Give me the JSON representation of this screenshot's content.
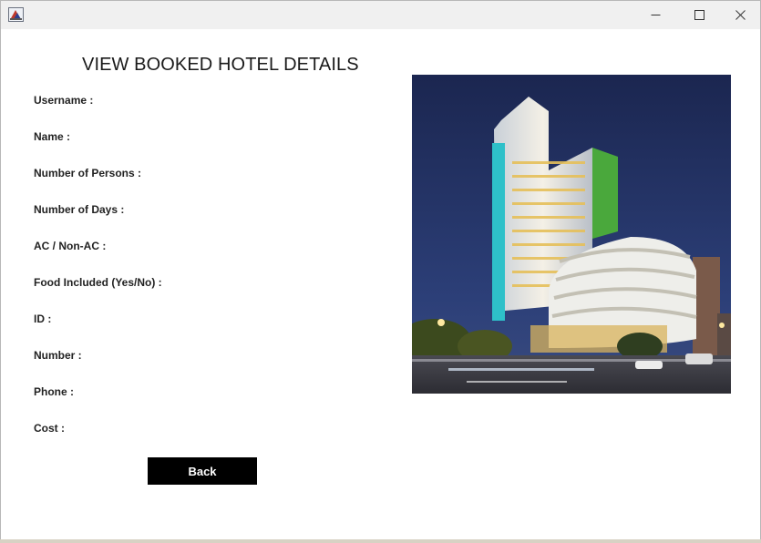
{
  "window": {
    "controls": {
      "minimize_icon": "minimize-icon",
      "maximize_icon": "maximize-icon",
      "close_icon": "close-icon"
    }
  },
  "main": {
    "title": "VIEW BOOKED HOTEL DETAILS",
    "fields": [
      {
        "label": "Username :"
      },
      {
        "label": "Name :"
      },
      {
        "label": "Number of Persons :"
      },
      {
        "label": "Number of Days :"
      },
      {
        "label": "AC / Non-AC :"
      },
      {
        "label": "Food Included (Yes/No) :"
      },
      {
        "label": "ID :"
      },
      {
        "label": "Number :"
      },
      {
        "label": "Phone :"
      },
      {
        "label": "Cost :"
      }
    ],
    "back_label": "Back"
  },
  "colors": {
    "button_bg": "#000000",
    "button_text": "#ffffff",
    "sky": "#1e2c5a"
  }
}
